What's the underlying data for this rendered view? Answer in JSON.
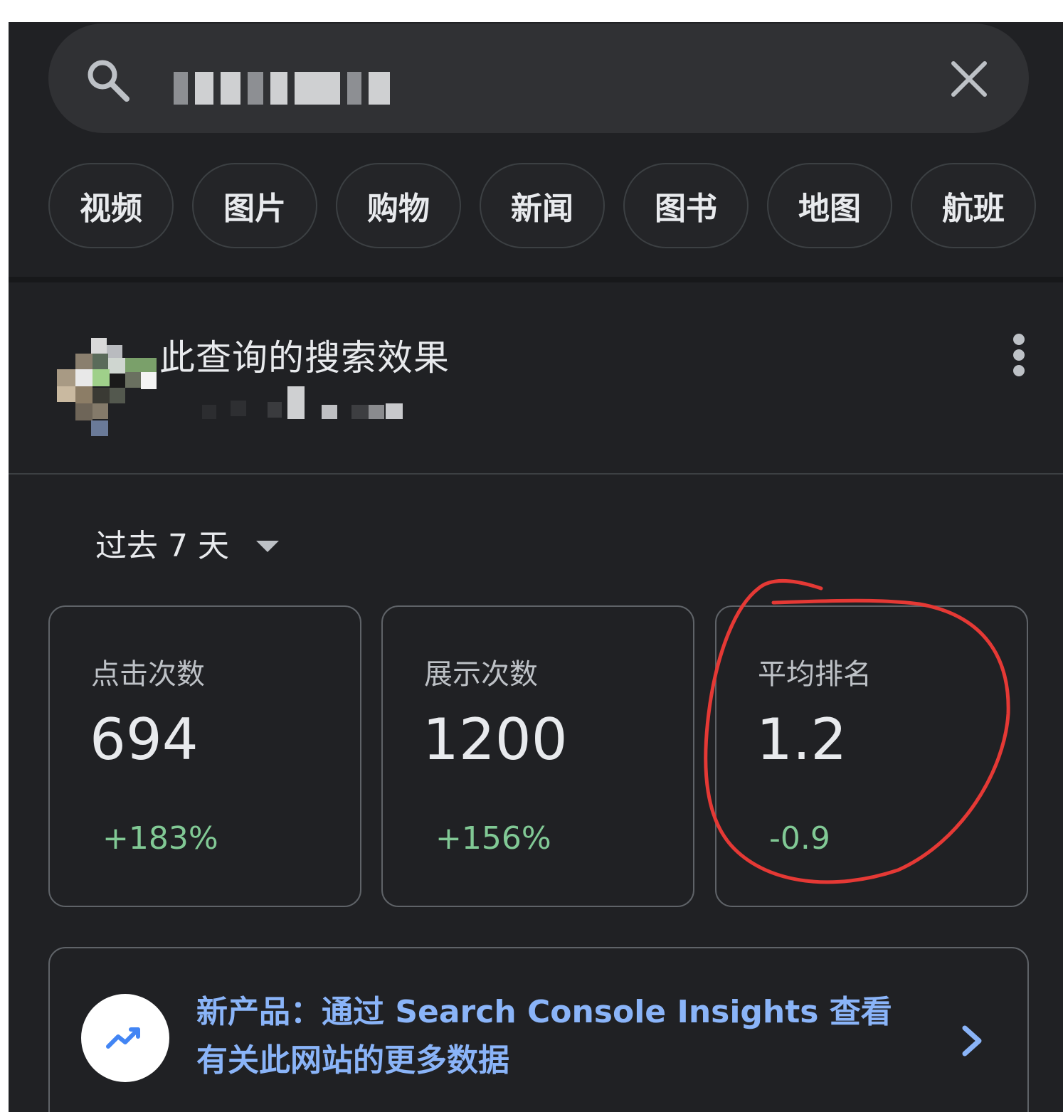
{
  "search": {
    "query": "",
    "clear_icon": "close-icon",
    "search_icon": "search-icon"
  },
  "chips": [
    {
      "label": "视频"
    },
    {
      "label": "图片"
    },
    {
      "label": "购物"
    },
    {
      "label": "新闻"
    },
    {
      "label": "图书"
    },
    {
      "label": "地图"
    },
    {
      "label": "航班"
    }
  ],
  "result": {
    "title": "此查询的搜索效果",
    "url": "",
    "menu_icon": "more-vert-icon"
  },
  "date_range": {
    "label": "过去 7 天"
  },
  "metrics": [
    {
      "label": "点击次数",
      "value": "694",
      "change": "+183%"
    },
    {
      "label": "展示次数",
      "value": "1200",
      "change": "+156%"
    },
    {
      "label": "平均排名",
      "value": "1.2",
      "change": "-0.9"
    }
  ],
  "promo": {
    "text": "新产品：通过 Search Console Insights 查看有关此网站的更多数据",
    "icon": "trending-up-icon"
  },
  "colors": {
    "background": "#202124",
    "positive": "#81c995",
    "link": "#8ab4f8",
    "annotation": "#e53935"
  }
}
